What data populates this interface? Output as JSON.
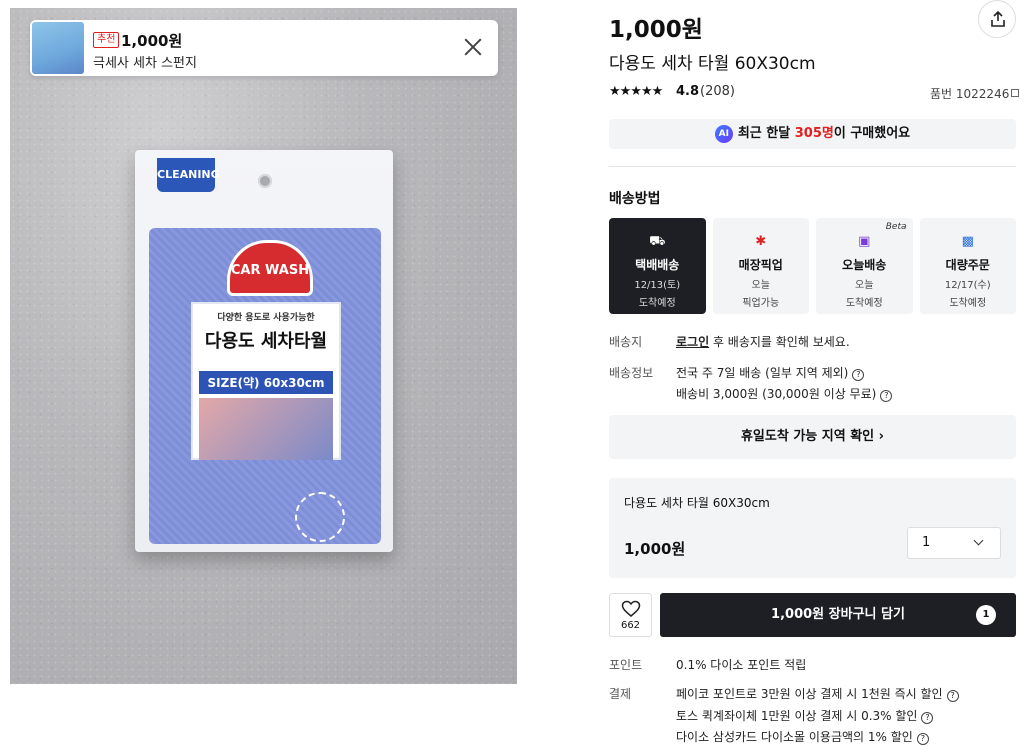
{
  "recommendation": {
    "tag": "추천",
    "price": "1,000원",
    "name": "극세사 세차 스펀지"
  },
  "product_image": {
    "tag": "CLEANING",
    "badge": "CAR WASH",
    "label_sub": "다양한 용도로 사용가능한",
    "label_title": "다용도 세차타월",
    "label_size": "SIZE(약) 60x30cm"
  },
  "product": {
    "price": "1,000원",
    "title": "다용도 세차 타월 60X30cm",
    "stars": "★★★★★",
    "rating": "4.8",
    "review_count": "(208)",
    "sku": "품번 1022246"
  },
  "ai_notice": {
    "badge": "AI",
    "prefix": "최근 한달 ",
    "highlight": "305명",
    "suffix": "이 구매했어요"
  },
  "shipping": {
    "heading": "배송방법",
    "options": [
      {
        "name": "택배배송",
        "line1": "12/13(토)",
        "line2": "도착예정",
        "icon": "truck-icon",
        "active": true
      },
      {
        "name": "매장픽업",
        "line1": "오늘",
        "line2": "픽업가능",
        "icon": "runner-icon"
      },
      {
        "name": "오늘배송",
        "line1": "오늘",
        "line2": "도착예정",
        "icon": "delivery-icon",
        "badge": "Beta"
      },
      {
        "name": "대량주문",
        "line1": "12/17(수)",
        "line2": "도착예정",
        "icon": "box-icon"
      }
    ]
  },
  "address": {
    "label": "배송지",
    "link": "로그인",
    "text": " 후 배송지를 확인해 보세요."
  },
  "ship_info": {
    "label": "배송정보",
    "line1": "전국 주 7일 배송 (일부 지역 제외)",
    "line2": "배송비 3,000원 (30,000원 이상 무료)"
  },
  "holiday_button": "휴일도착 가능 지역 확인",
  "option": {
    "name": "다용도 세차 타월 60X30cm",
    "price": "1,000원",
    "quantity": "1"
  },
  "actions": {
    "like_count": "662",
    "cart_label": "1,000원 장바구니 담기",
    "cart_count": "1"
  },
  "points": {
    "label": "포인트",
    "value": "0.1% 다이소 포인트 적립"
  },
  "payment": {
    "label": "결제",
    "items": [
      "페이코 포인트로 3만원 이상 결제 시 1천원 즉시 할인",
      "토스 퀵계좌이체 1만원 이상 결제 시 0.3% 할인",
      "다이소 삼성카드 다이소몰 이용금액의 1% 할인"
    ]
  }
}
